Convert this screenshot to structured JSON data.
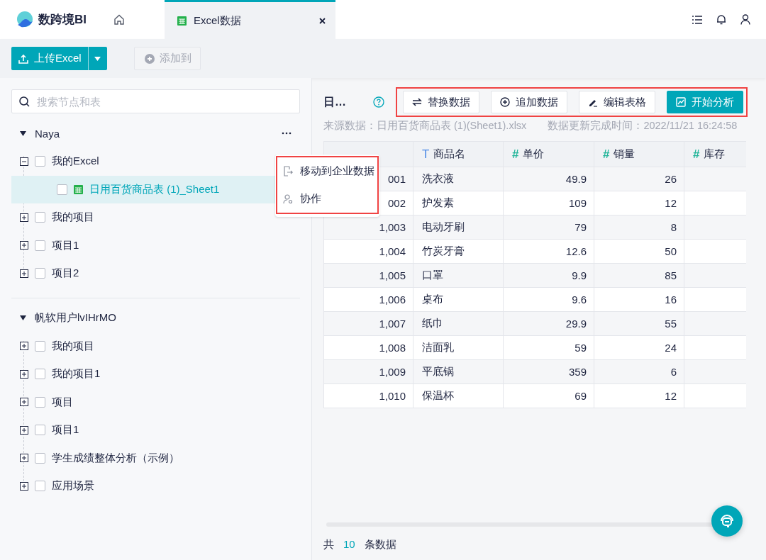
{
  "app": {
    "name": "数跨境BI"
  },
  "tabs": [
    {
      "label": "Excel数据",
      "selected": true
    }
  ],
  "toolbar": {
    "upload": "上传Excel",
    "add_to": {
      "label": "添加到",
      "disabled": true
    }
  },
  "sidebar": {
    "search": {
      "placeholder": "搜索节点和表"
    },
    "groups": [
      {
        "name": "Naya",
        "expanded": true,
        "items": [
          {
            "label": "我的Excel",
            "expanded": true,
            "checked": false,
            "selected": false,
            "children": [
              {
                "label": "日用百货商品表 (1)_Sheet1",
                "kind": "table",
                "checked": false,
                "selected": true
              }
            ]
          },
          {
            "label": "我的项目",
            "expanded": false,
            "checked": false,
            "selected": false
          },
          {
            "label": "项目1",
            "expanded": false,
            "checked": false,
            "selected": false
          },
          {
            "label": "项目2",
            "expanded": false,
            "checked": false,
            "selected": false
          }
        ]
      },
      {
        "name": "帆软用户lvIHrMO",
        "expanded": true,
        "items": [
          {
            "label": "我的项目",
            "expanded": false,
            "checked": false,
            "selected": false
          },
          {
            "label": "我的项目1",
            "expanded": false,
            "checked": false,
            "selected": false
          },
          {
            "label": "项目",
            "expanded": false,
            "checked": false,
            "selected": false
          },
          {
            "label": "项目1",
            "expanded": false,
            "checked": false,
            "selected": false
          },
          {
            "label": "学生成绩整体分析（示例）",
            "expanded": false,
            "checked": false,
            "selected": false
          },
          {
            "label": "应用场景",
            "expanded": false,
            "checked": false,
            "selected": false
          }
        ]
      }
    ]
  },
  "context_menu": {
    "highlighted": true,
    "items": [
      {
        "label": "移动到企业数据",
        "kind": "move"
      },
      {
        "label": "协作",
        "kind": "share"
      }
    ]
  },
  "detail": {
    "title": "日…",
    "highlighted": true,
    "actions": [
      {
        "label": "替换数据",
        "kind": "replace",
        "primary": false
      },
      {
        "label": "追加数据",
        "kind": "append",
        "primary": false
      },
      {
        "label": "编辑表格",
        "kind": "edit",
        "primary": false
      },
      {
        "label": "开始分析",
        "kind": "analyze",
        "primary": true
      }
    ],
    "source": "来源数据：日用百货商品表 (1)(Sheet1).xlsx",
    "updated": "数据更新完成时间：2022/11/21 16:24:58",
    "table": {
      "columns": [
        {
          "kind": "number"
        },
        {
          "name": "商品名",
          "kind": "text",
          "type_mark": "T"
        },
        {
          "name": "单价",
          "kind": "number",
          "type_mark": "#"
        },
        {
          "name": "销量",
          "kind": "number",
          "type_mark": "#"
        },
        {
          "name": "库存",
          "kind": "number",
          "type_mark": "#"
        }
      ],
      "rows": [
        [
          "001",
          "洗衣液",
          "49.9",
          "26"
        ],
        [
          "002",
          "护发素",
          "109",
          "12"
        ],
        [
          "1,003",
          "电动牙刷",
          "79",
          "8"
        ],
        [
          "1,004",
          "竹炭牙膏",
          "12.6",
          "50"
        ],
        [
          "1,005",
          "口罩",
          "9.9",
          "85"
        ],
        [
          "1,006",
          "桌布",
          "9.6",
          "16"
        ],
        [
          "1,007",
          "纸巾",
          "29.9",
          "55"
        ],
        [
          "1,008",
          "洁面乳",
          "59",
          "24"
        ],
        [
          "1,009",
          "平底锅",
          "359",
          "6"
        ],
        [
          "1,010",
          "保温杯",
          "69",
          "12"
        ]
      ]
    },
    "footer": {
      "prefix": "共",
      "count": "10",
      "suffix": "条数据"
    }
  }
}
